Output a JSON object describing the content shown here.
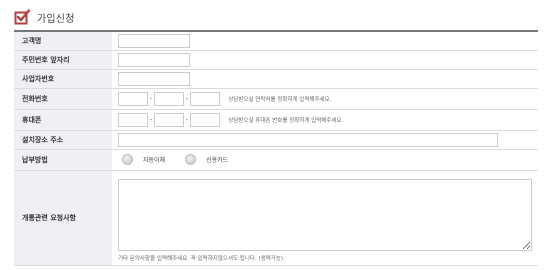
{
  "header": {
    "title": "가입신청",
    "icon": "checkbox-check-icon",
    "icon_color": "#b04040"
  },
  "form": {
    "customer_name": {
      "label": "고객명",
      "value": ""
    },
    "resident_number": {
      "label": "주민번호 앞자리",
      "value": ""
    },
    "business_number": {
      "label": "사업자번호",
      "value": ""
    },
    "phone": {
      "label": "전화번호",
      "part1": "",
      "part2": "",
      "part3": "",
      "separator": "-",
      "hint": "상담받으실 연락처를 정확히게 입력해주세요."
    },
    "mobile": {
      "label": "휴대폰",
      "part1": "",
      "part2": "",
      "part3": "",
      "separator": "-",
      "hint": "상담받으실 휴대폰 번호를 정확히게 입력해주세요."
    },
    "install_address": {
      "label": "설치장소 주소",
      "value": ""
    },
    "payment_method": {
      "label": "납부방법",
      "options": [
        "자동이체",
        "신용카드"
      ]
    },
    "request": {
      "label": "개통관련 요청사항",
      "value": "",
      "hint": "기타 문의사항을 입력해주세요. 꼭 입력하지않으셔도 됩니다. (생략가능)"
    }
  },
  "colors": {
    "label_bg": "#eef0f5",
    "border": "#dcdcdc",
    "top_border": "#777777"
  }
}
